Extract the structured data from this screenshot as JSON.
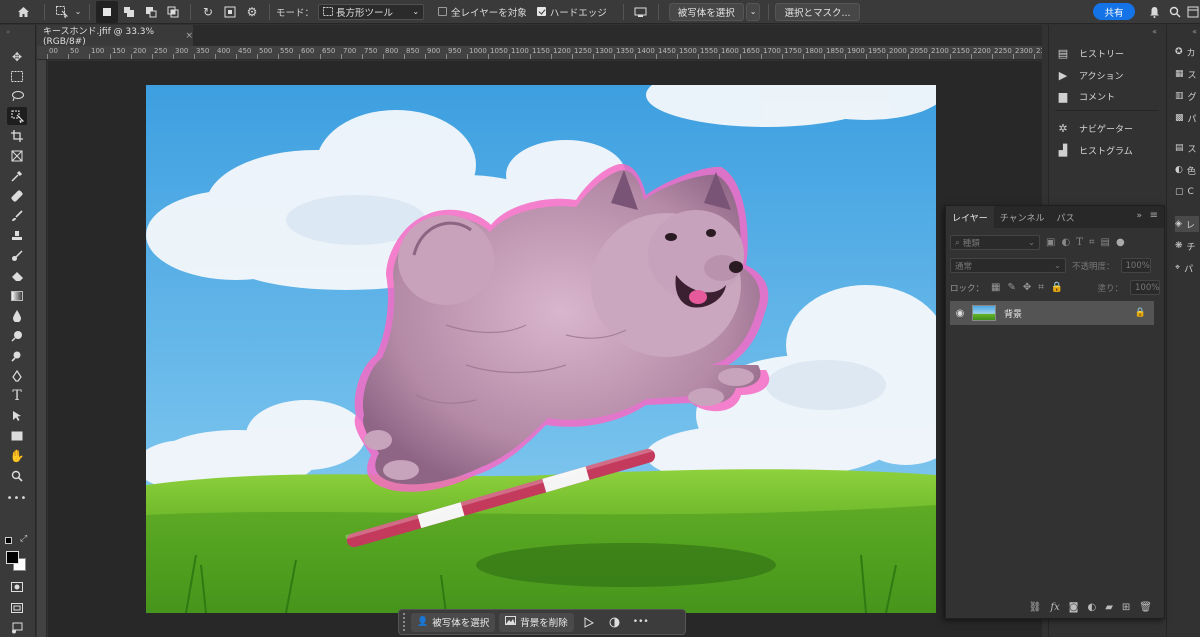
{
  "options_bar": {
    "mode_label": "モード：",
    "mode_value": "長方形ツール",
    "all_layers_label": "全レイヤーを対象",
    "hard_edge_label": "ハードエッジ",
    "select_subject_label": "被写体を選択",
    "select_mask_label": "選択とマスク...",
    "share_label": "共有"
  },
  "document": {
    "tab_title": "キースホンド.jfif @ 33.3% (RGB/8#)",
    "close": "×",
    "ruler_top": [
      "00",
      "50",
      "100",
      "150",
      "200",
      "250",
      "300",
      "350",
      "400",
      "450",
      "500",
      "550",
      "600",
      "650",
      "700",
      "750",
      "800",
      "850",
      "900",
      "950",
      "1000",
      "1050",
      "1100",
      "1150",
      "1200",
      "1250",
      "1300",
      "1350",
      "1400",
      "1450",
      "1500",
      "1550",
      "1600",
      "1650",
      "1700",
      "1750",
      "1800",
      "1850",
      "1900",
      "1950",
      "2000",
      "2050",
      "2100",
      "2150",
      "2200",
      "2250",
      "2300",
      "2350"
    ]
  },
  "context_bar": {
    "select_subject": "被写体を選択",
    "remove_bg": "背景を削除",
    "more": "•••"
  },
  "right_panels": {
    "items": [
      "ヒストリー",
      "アクション",
      "コメント",
      "ナビゲーター",
      "ヒストグラム"
    ],
    "collapsed": [
      "カ",
      "ス",
      "グ",
      "パ",
      "ス",
      "色",
      "C",
      "レ",
      "チ",
      "パ"
    ]
  },
  "layers_panel": {
    "tabs": [
      "レイヤー",
      "チャンネル",
      "パス"
    ],
    "kind_placeholder": "種類",
    "blend_mode": "通常",
    "opacity_label": "不透明度：",
    "opacity_value": "100%",
    "lock_label": "ロック：",
    "fill_label": "塗り：",
    "fill_value": "100%",
    "layer_name": "背景"
  },
  "colors": {
    "accent": "#1473e6",
    "foreground": "#000000",
    "background": "#ffffff"
  }
}
